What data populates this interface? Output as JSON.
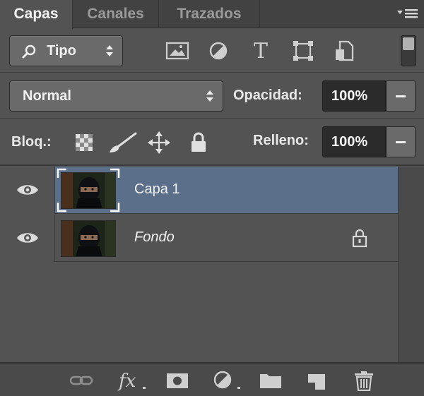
{
  "tabs": [
    {
      "label": "Capas",
      "active": true
    },
    {
      "label": "Canales",
      "active": false
    },
    {
      "label": "Trazados",
      "active": false
    }
  ],
  "filter": {
    "kind_label": "Tipo",
    "icons": [
      "image-filter-icon",
      "adjustment-filter-icon",
      "type-filter-icon",
      "shape-filter-icon",
      "smart-object-filter-icon"
    ]
  },
  "blend": {
    "mode": "Normal",
    "opacity_label": "Opacidad:",
    "opacity_value": "100%"
  },
  "lock": {
    "label": "Bloq.:",
    "fill_label": "Relleno:",
    "fill_value": "100%"
  },
  "layers": [
    {
      "name": "Capa 1",
      "selected": true,
      "italic": false,
      "locked": false,
      "visible": true
    },
    {
      "name": "Fondo",
      "selected": false,
      "italic": true,
      "locked": true,
      "visible": true
    }
  ],
  "bottom_icons": [
    "link-layers-icon",
    "layer-style-icon",
    "add-mask-icon",
    "new-adjustment-icon",
    "new-group-icon",
    "new-layer-icon",
    "delete-layer-icon"
  ],
  "colors": {
    "panel": "#535353",
    "selected_row": "#5b6f8a",
    "field_dark": "#2b2b2b"
  }
}
